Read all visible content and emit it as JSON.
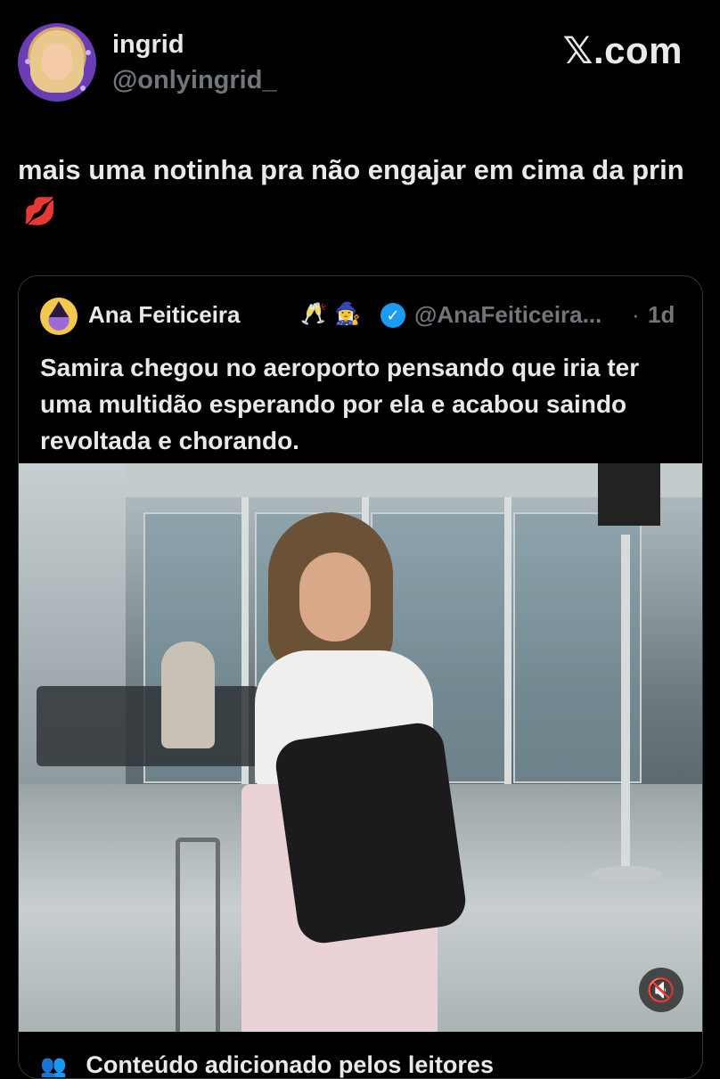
{
  "author": {
    "name": "ingrid",
    "handle": "@onlyingrid_"
  },
  "brand": "𝕏.com",
  "tweet": {
    "text": "mais uma notinha pra não engajar em cima da prin",
    "emoji": "💋"
  },
  "quoted": {
    "name": "Ana Feiticeira",
    "emoji_1": "🥂",
    "emoji_2": "🧙‍♀️",
    "verified_icon": "✓",
    "handle": "@AnaFeiticeira...",
    "separator": "·",
    "time": "1d",
    "text": "Samira chegou no aeroporto pensando que iria ter uma multidão esperando por ela e acabou saindo revoltada e chorando."
  },
  "media": {
    "mute_icon": "🔇"
  },
  "community_notes": {
    "icon": "👥",
    "label": "Conteúdo adicionado pelos leitores"
  }
}
